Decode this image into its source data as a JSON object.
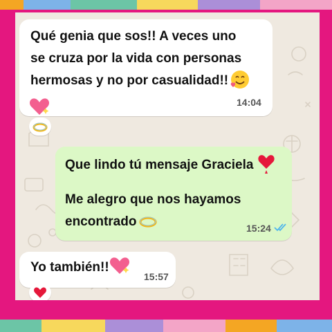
{
  "colors": {
    "frame": "#e4177f",
    "chat_background": "#efe9e0",
    "incoming_bubble": "#ffffff",
    "outgoing_bubble": "#dcf8c6",
    "read_ticks": "#4fb6ec"
  },
  "tape_colors": [
    "#f4a623",
    "#7db3e8",
    "#6cc5a6",
    "#f7d85c",
    "#ab8fd8",
    "#f3a5c7"
  ],
  "messages": [
    {
      "direction": "incoming",
      "lines": [
        "Qué genia que sos!! A veces uno",
        "se cruza por  la vida con personas",
        "hermosas y no por casualidad!!"
      ],
      "emojis": [
        "smiling-face-with-hearts",
        "sparkling-heart"
      ],
      "time": "14:04",
      "reaction": "halo-ring"
    },
    {
      "direction": "outgoing",
      "lines": [
        "Que lindo tú mensaje Graciela",
        "",
        "Me alegro que nos hayamos",
        "encontrado"
      ],
      "emojis": [
        "red-heart",
        "halo-ring"
      ],
      "time": "15:24",
      "status": "read"
    },
    {
      "direction": "incoming",
      "lines": [
        "Yo también!!"
      ],
      "emojis": [
        "sparkling-heart"
      ],
      "time": "15:57",
      "reaction": "red-heart"
    }
  ]
}
